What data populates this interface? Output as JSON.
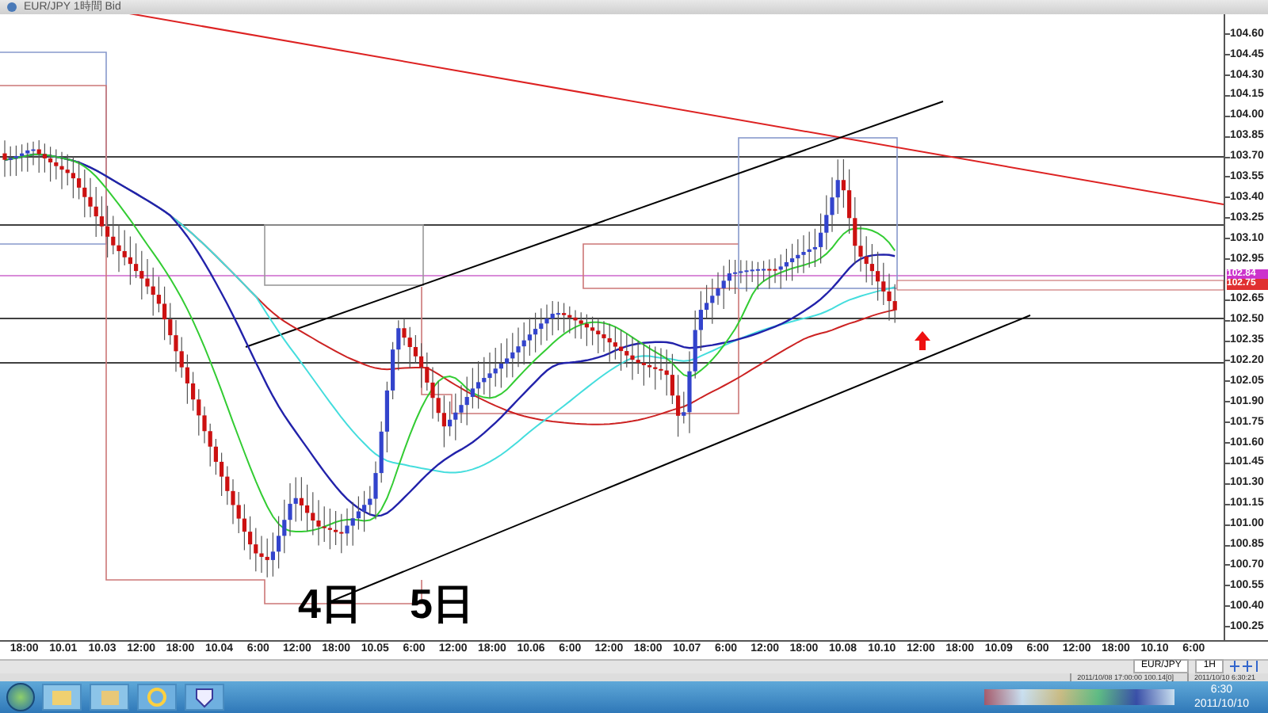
{
  "window": {
    "title": "EUR/JPY 1時間 Bid"
  },
  "chart": {
    "y_axis_labels": [
      "104.60",
      "104.45",
      "104.30",
      "104.15",
      "104.00",
      "103.85",
      "103.70",
      "103.55",
      "103.40",
      "103.25",
      "103.10",
      "102.95",
      "102.65",
      "102.50",
      "102.35",
      "102.20",
      "102.05",
      "101.90",
      "101.75",
      "101.60",
      "101.45",
      "101.30",
      "101.15",
      "101.00",
      "100.85",
      "100.70",
      "100.55",
      "100.40",
      "100.25"
    ],
    "price_tags": [
      {
        "text": "102.84",
        "color": "#cc33cc"
      },
      {
        "text": "102.75",
        "color": "#e03030"
      }
    ],
    "annotations": [
      "4日",
      "5日"
    ],
    "x_axis_labels": [
      "18:00",
      "10.01",
      "10.03",
      "12:00",
      "18:00",
      "10.04",
      "6:00",
      "12:00",
      "18:00",
      "10.05",
      "6:00",
      "12:00",
      "18:00",
      "10.06",
      "6:00",
      "12:00",
      "18:00",
      "10.07",
      "6:00",
      "12:00",
      "18:00",
      "10.08",
      "10.10",
      "12:00",
      "18:00",
      "10.09",
      "6:00",
      "12:00",
      "18:00",
      "10.10",
      "6:00"
    ]
  },
  "toolbar": {
    "symbol": "EUR/JPY",
    "timeframe": "1H"
  },
  "status_bar": [
    "2011/10/08 17:00:00  100.14[0]",
    "2011/10/10 6:30:21"
  ],
  "taskbar": {
    "time": "6:30",
    "date": "2011/10/10"
  }
}
